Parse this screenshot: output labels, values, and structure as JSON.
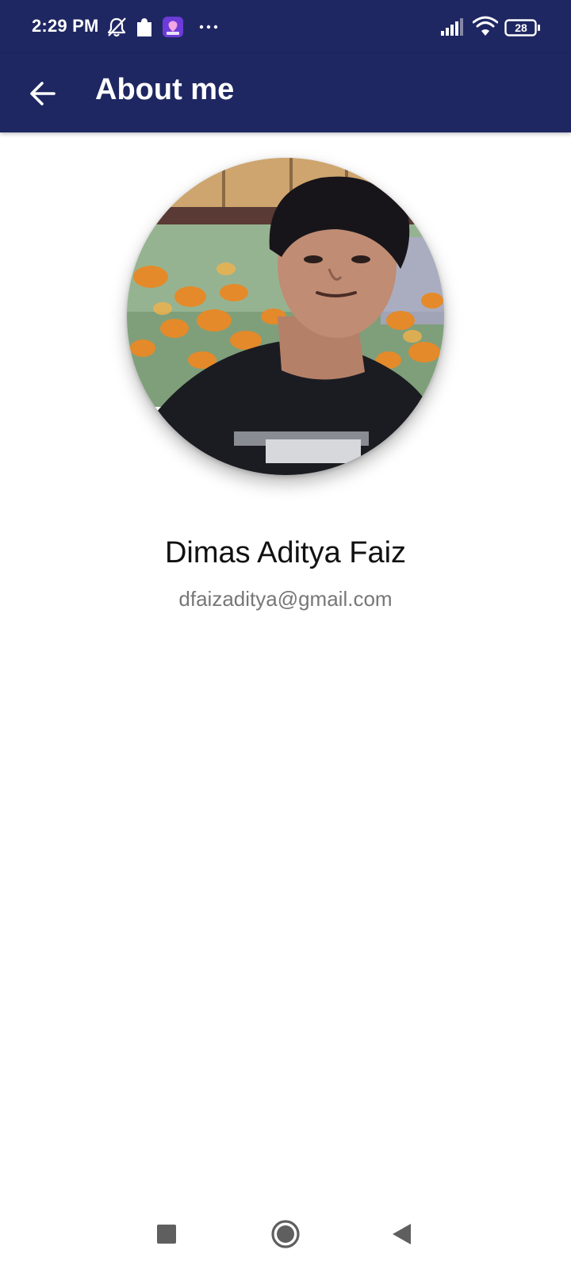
{
  "status_bar": {
    "time": "2:29 PM",
    "icons": [
      "notifications-off-icon",
      "puzzle-icon",
      "app-notification-icon",
      "more-dots-icon",
      "cellular-signal-icon",
      "wifi-icon",
      "battery-icon"
    ],
    "battery_level": "28"
  },
  "app_bar": {
    "title": "About me",
    "back_icon": "arrow-left-icon"
  },
  "profile": {
    "photo": "profile-photo",
    "name": "Dimas Aditya Faiz",
    "email": "dfaizaditya@gmail.com"
  },
  "nav_bar": {
    "buttons": [
      "recent-apps-icon",
      "home-icon",
      "back-icon"
    ]
  },
  "colors": {
    "primary": "#1f2762",
    "on_primary": "#ffffff",
    "background": "#ffffff",
    "name_text": "#111111",
    "email_text": "#777777",
    "nav_icon": "#5f5f5f"
  }
}
